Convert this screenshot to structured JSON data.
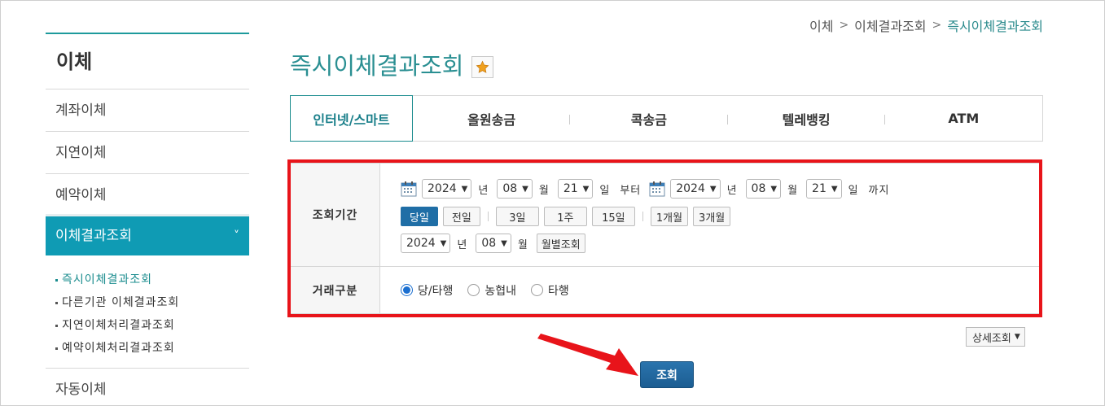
{
  "breadcrumb": {
    "items": [
      "이체",
      "이체결과조회",
      "즉시이체결과조회"
    ],
    "sep": ">"
  },
  "sidebar": {
    "title": "이체",
    "items": [
      "계좌이체",
      "지연이체",
      "예약이체"
    ],
    "active_item": "이체결과조회",
    "active_chevron": "˅",
    "sub_items": [
      "즉시이체결과조회",
      "다른기관 이체결과조회",
      "지연이체처리결과조회",
      "예약이체처리결과조회"
    ],
    "after_item": "자동이체"
  },
  "page": {
    "title": "즉시이체결과조회",
    "favorite_icon": "star-icon"
  },
  "tabs": [
    "인터넷/스마트",
    "올원송금",
    "콕송금",
    "텔레뱅킹",
    "ATM"
  ],
  "form": {
    "period_label": "조회기간",
    "from": {
      "year": "2024",
      "month": "08",
      "day": "21"
    },
    "to": {
      "year": "2024",
      "month": "08",
      "day": "21"
    },
    "units": {
      "year": "년",
      "month": "월",
      "day": "일",
      "from_suffix": "부터",
      "to_suffix": "까지"
    },
    "quick_buttons": {
      "today": "당일",
      "prev_day": "전일",
      "d3": "3일",
      "w1": "1주",
      "d15": "15일",
      "m1": "1개월",
      "m3": "3개월"
    },
    "monthly": {
      "year": "2024",
      "month": "08",
      "button": "월별조회"
    },
    "type_label": "거래구분",
    "types": [
      "당/타행",
      "농협내",
      "타행"
    ],
    "selected_type": "당/타행"
  },
  "detail_button": "상세조회",
  "search_button": "조회",
  "colors": {
    "teal": "#1a8c8e",
    "active_nav": "#0f9bb4",
    "primary": "#1f6ea6",
    "highlight": "#e8141a"
  }
}
